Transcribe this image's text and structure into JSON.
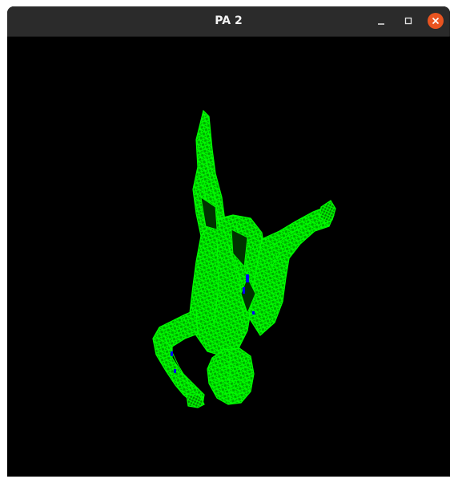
{
  "window": {
    "title": "PA 2"
  },
  "titlebar": {
    "buttons": [
      "minimize",
      "maximize",
      "close"
    ],
    "close_color": "#e95420"
  },
  "scene": {
    "background_color": "#000000",
    "wireframe_color": "#00ff00",
    "accent_color": "#0000ff",
    "subject": "wireframe-human-figure"
  }
}
